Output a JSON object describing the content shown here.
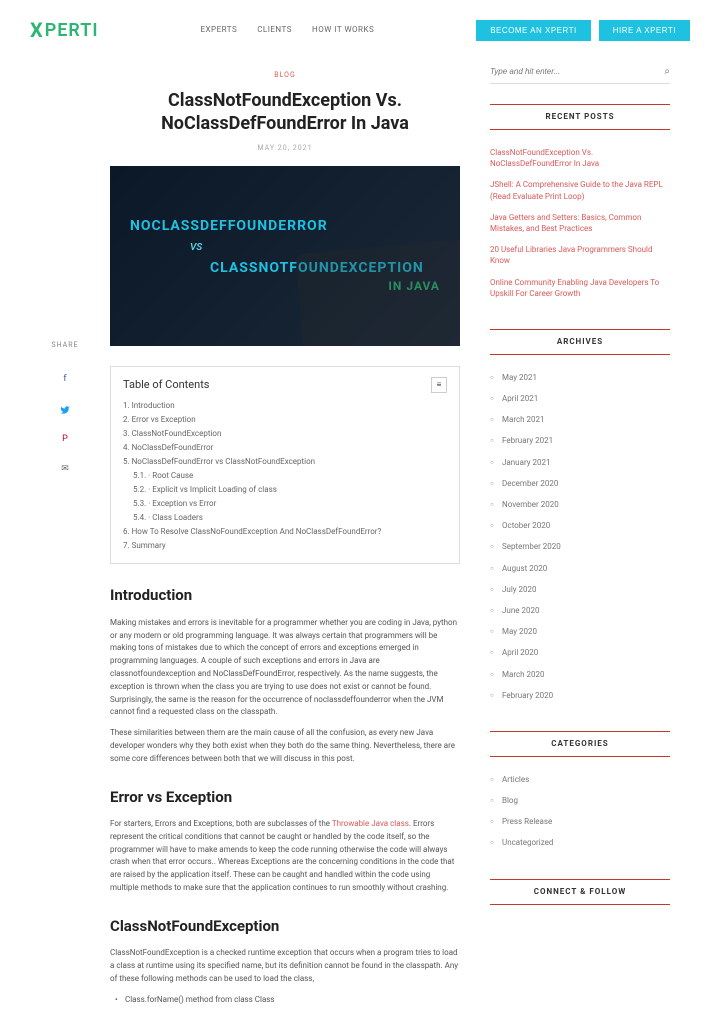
{
  "header": {
    "logo_text": "PERTI",
    "nav": {
      "experts": "EXPERTS",
      "clients": "CLIENTS",
      "howit": "HOW IT WORKS"
    },
    "btn_become": "BECOME AN XPERTI",
    "btn_hire": "HIRE A XPERTI"
  },
  "share": {
    "label": "SHARE"
  },
  "article": {
    "breadcrumb": "BLOG",
    "title": "ClassNotFoundException Vs. NoClassDefFoundError In Java",
    "date": "MAY 20, 2021",
    "hero": {
      "line1": "NOCLASSDEFFOUNDERROR",
      "vs": "VS",
      "line2": "CLASSNOTFOUNDEXCEPTION",
      "injava": "IN JAVA"
    }
  },
  "toc": {
    "title": "Table of Contents",
    "items": [
      "1. Introduction",
      "2. Error vs Exception",
      "3. ClassNotFoundException",
      "4. NoClassDefFoundError",
      "5. NoClassDefFoundError vs ClassNotFoundException",
      "5.1. · Root Cause",
      "5.2. · Explicit vs Implicit Loading of class",
      "5.3. · Exception vs Error",
      "5.4. · Class Loaders",
      "6. How To Resolve ClassNoFoundException And NoClassDefFoundError?",
      "7. Summary"
    ]
  },
  "sections": {
    "intro": {
      "h": "Introduction",
      "p1": "Making mistakes and errors is inevitable for a programmer whether you are coding in Java, python or any modern or old programming language. It was always certain that programmers will be making tons of mistakes due to which the concept of errors and exceptions emerged in programming languages. A couple of such exceptions and errors in Java are classnotfoundexception and NoClassDefFoundError, respectively. As the name suggests, the exception is thrown when the class you are trying to use does not exist or cannot be found. Surprisingly, the same is the reason for the occurrence of noclassdeffounderror when the JVM cannot find a requested class on the classpath.",
      "p2": "These similarities between them are the main cause of all the confusion, as every new Java developer wonders why they both exist when they both do the same thing. Nevertheless, there are some core differences between both that we will discuss in this post."
    },
    "errvsexc": {
      "h": "Error vs Exception",
      "p1a": "For starters, Errors and Exceptions, both are subclasses of the ",
      "link": "Throwable Java class",
      "p1b": ". Errors represent the critical conditions that cannot be caught or handled by the code itself, so the programmer will have to make amends to keep the code running otherwise the code will always crash when that error occurs.. Whereas Exceptions are the concerning conditions in the code that are raised by the application itself. These can be caught and handled within the code using multiple methods to make sure that the application continues to run smoothly without crashing."
    },
    "cnfe": {
      "h": "ClassNotFoundException",
      "p1": "ClassNotFoundException is a checked runtime exception that occurs when a program tries to load a class at runtime using its specified name, but its definition cannot be found in the classpath. Any of these following methods can be used to load the class,",
      "bullet": "Class.forName() method from class Class"
    }
  },
  "sidebar": {
    "search_placeholder": "Type and hit enter...",
    "recent": {
      "title": "RECENT POSTS",
      "items": [
        "ClassNotFoundException Vs. NoClassDefFoundError In Java",
        "JShell: A Comprehensive Guide to the Java REPL (Read Evaluate Print Loop)",
        "Java Getters and Setters: Basics, Common Mistakes, and Best Practices",
        "20 Useful Libraries Java Programmers Should Know",
        "Online Community Enabling Java Developers To Upskill For Career Growth"
      ]
    },
    "archives": {
      "title": "ARCHIVES",
      "items": [
        "May 2021",
        "April 2021",
        "March 2021",
        "February 2021",
        "January 2021",
        "December 2020",
        "November 2020",
        "October 2020",
        "September 2020",
        "August 2020",
        "July 2020",
        "June 2020",
        "May 2020",
        "April 2020",
        "March 2020",
        "February 2020"
      ]
    },
    "categories": {
      "title": "CATEGORIES",
      "items": [
        "Articles",
        "Blog",
        "Press Release",
        "Uncategorized"
      ]
    },
    "connect": {
      "title": "CONNECT & FOLLOW"
    }
  }
}
